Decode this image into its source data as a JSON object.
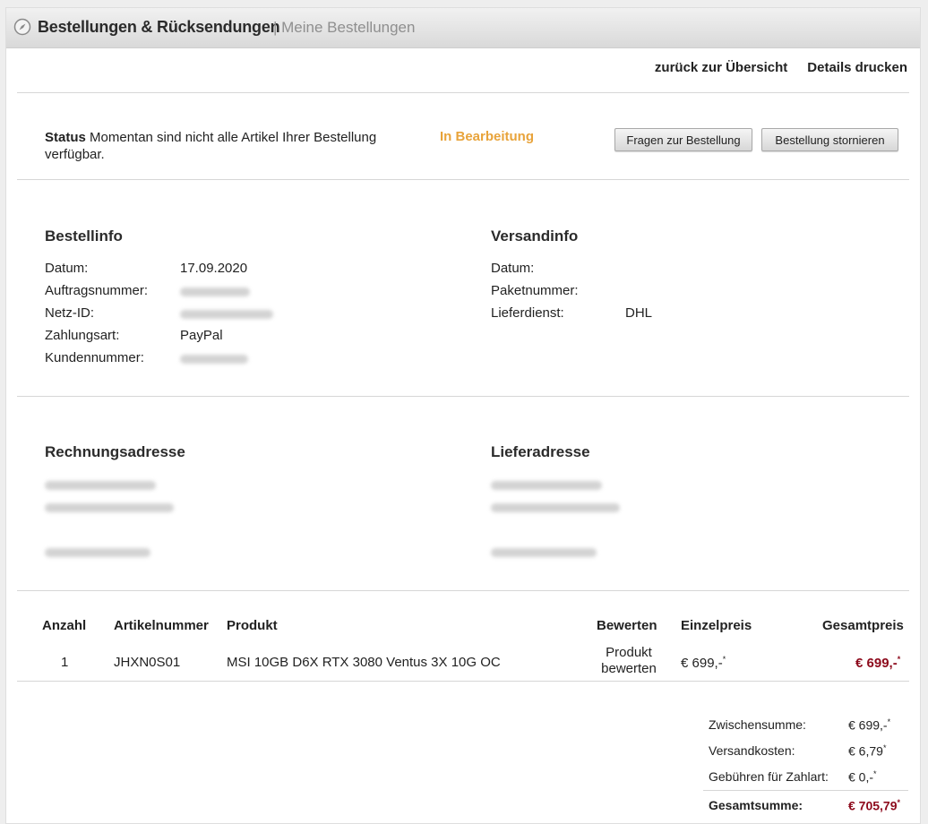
{
  "header": {
    "title": "Bestellungen & Rücksendungen",
    "subtitle": "| Meine Bestellungen"
  },
  "nav": {
    "back_link": "zurück zur Übersicht",
    "print_link": "Details drucken"
  },
  "status": {
    "label": "Status",
    "message": "Momentan sind nicht alle Artikel Ihrer Bestellung verfügbar.",
    "value": "In Bearbeitung",
    "question_button": "Fragen zur Bestellung",
    "cancel_button": "Bestellung stornieren"
  },
  "order_info": {
    "title": "Bestellinfo",
    "date_label": "Datum:",
    "date_value": "17.09.2020",
    "order_number_label": "Auftragsnummer:",
    "net_id_label": "Netz-ID:",
    "payment_label": "Zahlungsart:",
    "payment_value": "PayPal",
    "customer_number_label": "Kundennummer:"
  },
  "shipping_info": {
    "title": "Versandinfo",
    "date_label": "Datum:",
    "package_label": "Paketnummer:",
    "carrier_label": "Lieferdienst:",
    "carrier_value": "DHL"
  },
  "addresses": {
    "billing_title": "Rechnungsadresse",
    "delivery_title": "Lieferadresse"
  },
  "table": {
    "headers": {
      "qty": "Anzahl",
      "article": "Artikelnummer",
      "product": "Produkt",
      "rate": "Bewerten",
      "unit_price": "Einzelpreis",
      "total_price": "Gesamtpreis"
    },
    "rows": [
      {
        "qty": "1",
        "article": "JHXN0S01",
        "product": "MSI 10GB D6X RTX 3080 Ventus 3X 10G OC",
        "rate_line1": "Produkt",
        "rate_line2": "bewerten",
        "unit_price": "€ 699,-",
        "total_price": "€ 699,-"
      }
    ]
  },
  "summary": {
    "subtotal_label": "Zwischensumme:",
    "subtotal_value": "€ 699,-",
    "shipping_label": "Versandkosten:",
    "shipping_value": "€ 6,79",
    "fee_label": "Gebühren für Zahlart:",
    "fee_value": "€ 0,-",
    "total_label": "Gesamtsumme:",
    "total_value": "€ 705,79",
    "asterisk": "*"
  },
  "colors": {
    "status_accent": "#e8a33a",
    "price_red": "#8d0a1c"
  }
}
